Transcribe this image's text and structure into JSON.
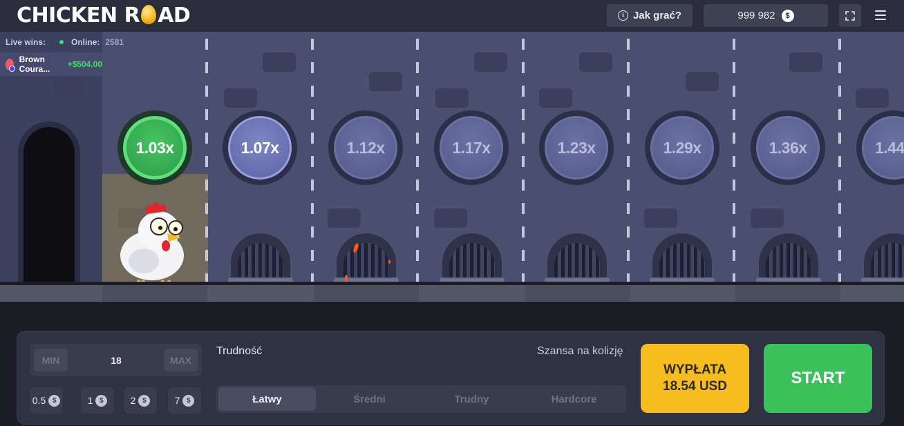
{
  "header": {
    "logo_text_1": "CHICKEN R",
    "logo_text_2": "AD",
    "how_to_play": "Jak grać?",
    "balance": "999 982",
    "currency_symbol": "$"
  },
  "live": {
    "live_wins_label": "Live wins:",
    "online_label": "Online:",
    "online_count": "2581",
    "entries": [
      {
        "player": "Brown Coura...",
        "amount": "+$504.00"
      }
    ]
  },
  "multipliers": [
    {
      "value": "1.03x",
      "state": "done"
    },
    {
      "value": "1.07x",
      "state": "next"
    },
    {
      "value": "1.12x",
      "state": "locked"
    },
    {
      "value": "1.17x",
      "state": "locked"
    },
    {
      "value": "1.23x",
      "state": "locked"
    },
    {
      "value": "1.29x",
      "state": "locked"
    },
    {
      "value": "1.36x",
      "state": "locked"
    },
    {
      "value": "1.44",
      "state": "locked"
    }
  ],
  "bet": {
    "min_label": "MIN",
    "max_label": "MAX",
    "amount": "18",
    "quick_chips": [
      "0.5",
      "1",
      "2",
      "7"
    ]
  },
  "difficulty": {
    "label": "Trudność",
    "chance_label": "Szansa na kolizję",
    "options": [
      "Łatwy",
      "Średni",
      "Trudny",
      "Hardcore"
    ],
    "selected": "Łatwy"
  },
  "actions": {
    "cashout_line1": "WYPŁATA",
    "cashout_line2": "18.54 USD",
    "start": "START"
  },
  "colors": {
    "accent_green": "#39c15a",
    "cashout_yellow": "#f7bd1e",
    "road": "#4a4f70"
  }
}
